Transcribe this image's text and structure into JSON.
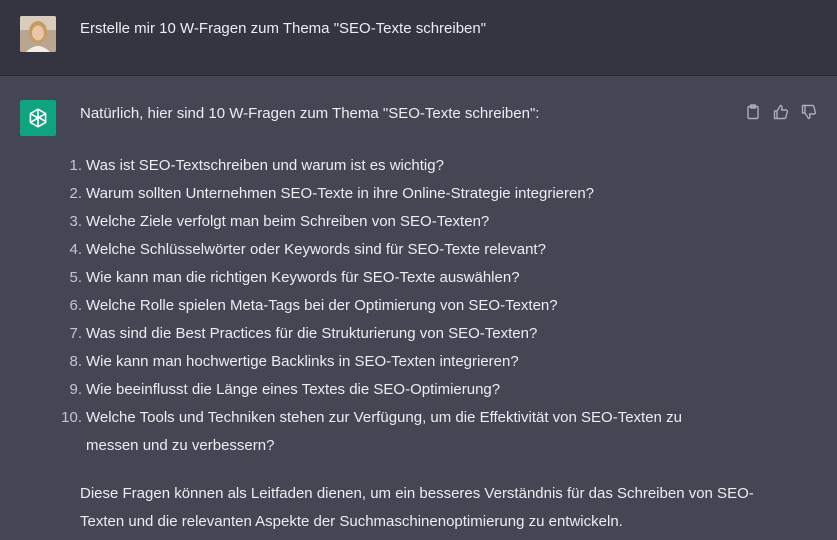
{
  "user_message": {
    "text": "Erstelle mir 10 W-Fragen zum Thema \"SEO-Texte schreiben\""
  },
  "assistant_message": {
    "intro": "Natürlich, hier sind 10 W-Fragen zum Thema \"SEO-Texte schreiben\":",
    "questions": [
      {
        "num": "1.",
        "text": "Was ist SEO-Textschreiben und warum ist es wichtig?"
      },
      {
        "num": "2.",
        "text": "Warum sollten Unternehmen SEO-Texte in ihre Online-Strategie integrieren?"
      },
      {
        "num": "3.",
        "text": "Welche Ziele verfolgt man beim Schreiben von SEO-Texten?"
      },
      {
        "num": "4.",
        "text": "Welche Schlüsselwörter oder Keywords sind für SEO-Texte relevant?"
      },
      {
        "num": "5.",
        "text": "Wie kann man die richtigen Keywords für SEO-Texte auswählen?"
      },
      {
        "num": "6.",
        "text": "Welche Rolle spielen Meta-Tags bei der Optimierung von SEO-Texten?"
      },
      {
        "num": "7.",
        "text": "Was sind die Best Practices für die Strukturierung von SEO-Texten?"
      },
      {
        "num": "8.",
        "text": "Wie kann man hochwertige Backlinks in SEO-Texten integrieren?"
      },
      {
        "num": "9.",
        "text": "Wie beeinflusst die Länge eines Textes die SEO-Optimierung?"
      },
      {
        "num": "10.",
        "text": "Welche Tools und Techniken stehen zur Verfügung, um die Effektivität von SEO-Texten zu messen und zu verbessern?"
      }
    ],
    "outro": "Diese Fragen können als Leitfaden dienen, um ein besseres Verständnis für das Schreiben von SEO-Texten und die relevanten Aspekte der Suchmaschinenoptimierung zu entwickeln."
  },
  "icons": {
    "copy": "clipboard-icon",
    "like": "thumbs-up-icon",
    "dislike": "thumbs-down-icon",
    "bot": "openai-logo-icon"
  },
  "colors": {
    "user_bg": "#343541",
    "assistant_bg": "#444654",
    "bot_avatar": "#10a37f",
    "text": "#ececf1"
  }
}
